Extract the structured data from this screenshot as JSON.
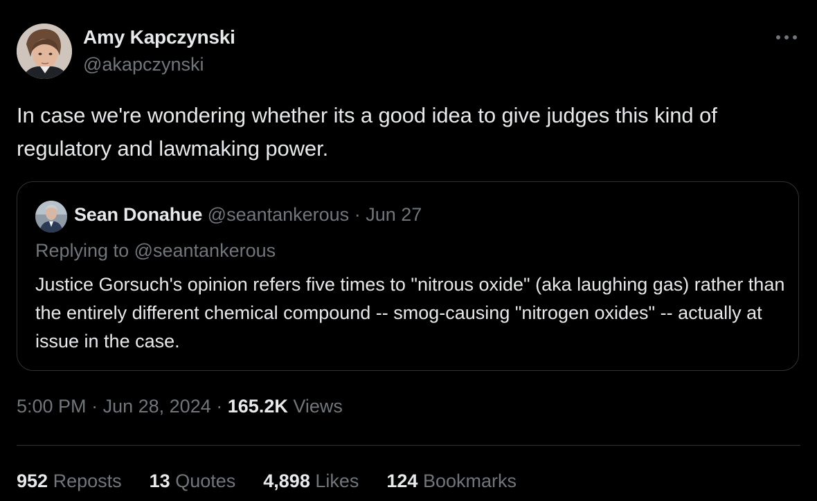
{
  "colors": {
    "background": "#000000",
    "primary_text": "#e7e9ea",
    "secondary_text": "#71767b",
    "border": "#2f3336"
  },
  "tweet": {
    "author": {
      "name": "Amy Kapczynski",
      "handle": "@akapczynski",
      "avatar_icon": "user-avatar"
    },
    "more_icon": "more-horizontal-icon",
    "text": "In case we're wondering whether its a good idea to give judges this kind of regulatory and lawmaking power.",
    "quote": {
      "avatar_icon": "user-avatar",
      "name": "Sean Donahue",
      "handle": "@seantankerous",
      "separator": "·",
      "date": "Jun 27",
      "replying": "Replying to @seantankerous",
      "text": "Justice Gorsuch's opinion refers five times to \"nitrous oxide\" (aka laughing gas) rather than the entirely different chemical compound -- smog-causing \"nitrogen oxides\" -- actually at issue in the case."
    },
    "meta": {
      "time": "5:00 PM",
      "separator": "·",
      "date": "Jun 28, 2024",
      "views_count": "165.2K",
      "views_label": "Views"
    },
    "stats": {
      "reposts": {
        "count": "952",
        "label": "Reposts"
      },
      "quotes": {
        "count": "13",
        "label": "Quotes"
      },
      "likes": {
        "count": "4,898",
        "label": "Likes"
      },
      "bookmarks": {
        "count": "124",
        "label": "Bookmarks"
      }
    }
  }
}
